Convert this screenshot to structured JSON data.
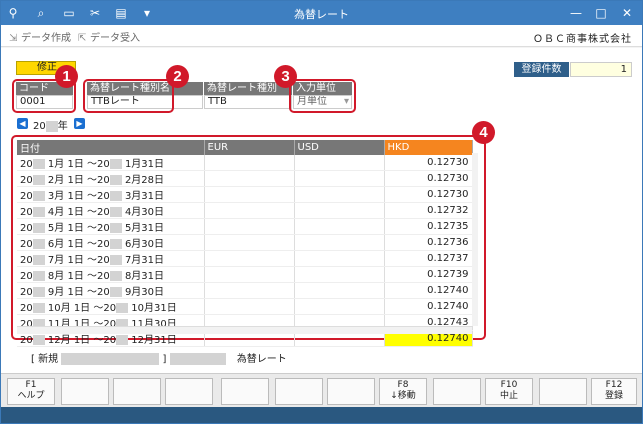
{
  "window": {
    "title": "為替レート",
    "controls": [
      "—",
      "□",
      "✕"
    ]
  },
  "toolbar": {
    "create_data": "データ作成",
    "import_data": "データ受入",
    "company": "ＯＢＣ商事株式会社"
  },
  "form": {
    "edit_mode": "修正",
    "count_label": "登録件数",
    "count_value": "1",
    "code_label": "コード",
    "code_value": "0001",
    "rate_type_name_label": "為替レート種別名",
    "rate_type_name_value": "TTBレート",
    "rate_type_label": "為替レート種別",
    "rate_type_value": "TTB",
    "input_unit_label": "入力単位",
    "input_unit_value": "月単位"
  },
  "year_nav": {
    "prefix": "20",
    "suffix": "年"
  },
  "grid": {
    "headers": [
      "日付",
      "EUR",
      "USD",
      "HKD"
    ],
    "rows": [
      {
        "year": "20",
        "start": "1月 1日",
        "tilde": "～20",
        "end": "1月31日",
        "eur": "",
        "usd": "",
        "hkd": "0.12730"
      },
      {
        "year": "20",
        "start": "2月 1日",
        "tilde": "～20",
        "end": "2月28日",
        "eur": "",
        "usd": "",
        "hkd": "0.12730"
      },
      {
        "year": "20",
        "start": "3月 1日",
        "tilde": "～20",
        "end": "3月31日",
        "eur": "",
        "usd": "",
        "hkd": "0.12730"
      },
      {
        "year": "20",
        "start": "4月 1日",
        "tilde": "～20",
        "end": "4月30日",
        "eur": "",
        "usd": "",
        "hkd": "0.12732"
      },
      {
        "year": "20",
        "start": "5月 1日",
        "tilde": "～20",
        "end": "5月31日",
        "eur": "",
        "usd": "",
        "hkd": "0.12735"
      },
      {
        "year": "20",
        "start": "6月 1日",
        "tilde": "～20",
        "end": "6月30日",
        "eur": "",
        "usd": "",
        "hkd": "0.12736"
      },
      {
        "year": "20",
        "start": "7月 1日",
        "tilde": "～20",
        "end": "7月31日",
        "eur": "",
        "usd": "",
        "hkd": "0.12737"
      },
      {
        "year": "20",
        "start": "8月 1日",
        "tilde": "～20",
        "end": "8月31日",
        "eur": "",
        "usd": "",
        "hkd": "0.12739"
      },
      {
        "year": "20",
        "start": "9月 1日",
        "tilde": "～20",
        "end": "9月30日",
        "eur": "",
        "usd": "",
        "hkd": "0.12740"
      },
      {
        "year": "20",
        "start": "10月 1日",
        "tilde": "～20",
        "end": "10月31日",
        "eur": "",
        "usd": "",
        "hkd": "0.12740"
      },
      {
        "year": "20",
        "start": "11月 1日",
        "tilde": "～20",
        "end": "11月30日",
        "eur": "",
        "usd": "",
        "hkd": "0.12743"
      },
      {
        "year": "20",
        "start": "12月 1日",
        "tilde": "～20",
        "end": "12月31日",
        "eur": "",
        "usd": "",
        "hkd": "0.12740"
      }
    ]
  },
  "callouts": [
    "1",
    "2",
    "3",
    "4"
  ],
  "status": {
    "new_prefix": "[ 新規",
    "close_bracket": "]",
    "text": "為替レート"
  },
  "function_keys": [
    {
      "key": "F1",
      "label": "ヘルプ"
    },
    {
      "key": "",
      "label": ""
    },
    {
      "key": "",
      "label": ""
    },
    {
      "key": "",
      "label": ""
    },
    {
      "key": "",
      "label": ""
    },
    {
      "key": "",
      "label": ""
    },
    {
      "key": "",
      "label": ""
    },
    {
      "key": "F8",
      "label": "↓移動"
    },
    {
      "key": "",
      "label": ""
    },
    {
      "key": "F10",
      "label": "中止"
    },
    {
      "key": "",
      "label": ""
    },
    {
      "key": "F12",
      "label": "登録"
    }
  ],
  "colors": {
    "titlebar": "#3e7fc1",
    "accent_hkd": "#f5851f",
    "highlight": "#ffff00",
    "callout": "#d1192a"
  }
}
